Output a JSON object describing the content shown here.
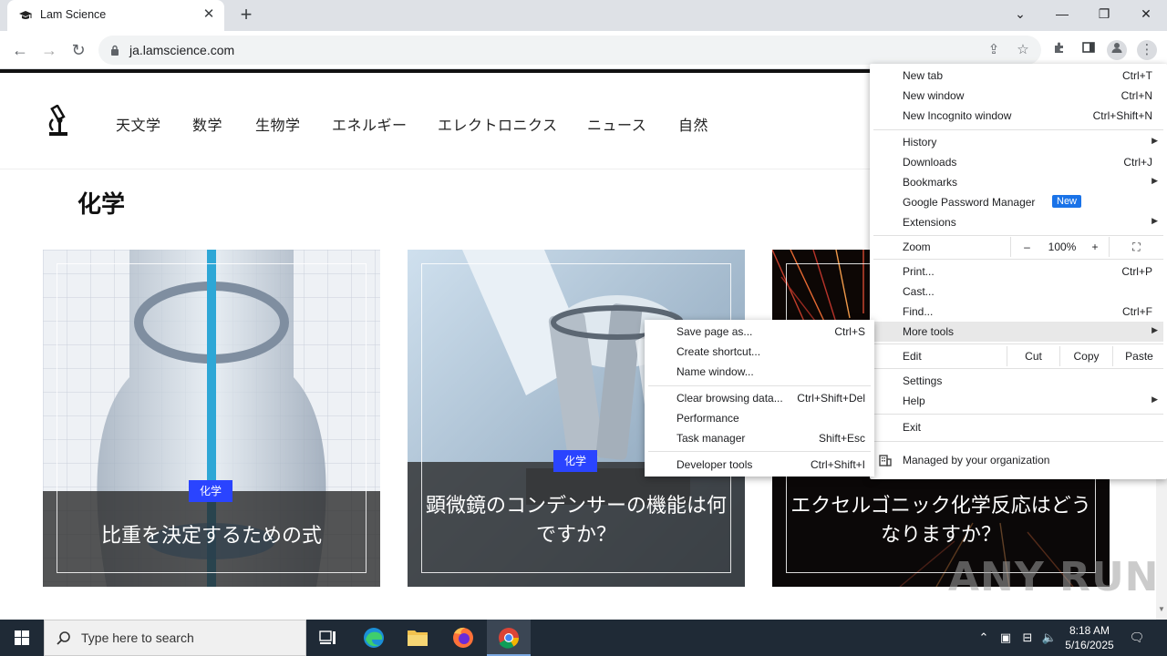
{
  "browser": {
    "tab_title": "Lam Science",
    "url": "ja.lamscience.com",
    "icons": [
      "back-icon",
      "forward-icon",
      "reload-icon",
      "lock-icon",
      "share-icon",
      "star-icon",
      "extensions-icon",
      "sidepanel-icon",
      "profile-icon",
      "menu-icon"
    ]
  },
  "site": {
    "nav": [
      "天文学",
      "数学",
      "生物学",
      "エネルギー",
      "エレクトロニクス",
      "ニュース",
      "自然"
    ],
    "section_title": "化学",
    "cards": [
      {
        "badge": "化学",
        "title": "比重を決定するための式"
      },
      {
        "badge": "化学",
        "title": "顕微鏡のコンデンサーの機能は何ですか？"
      },
      {
        "badge": "",
        "title": "エクセルゴニック化学反応はどうなりますか？"
      }
    ]
  },
  "menu": {
    "items": [
      {
        "label": "New tab",
        "shortcut": "Ctrl+T"
      },
      {
        "label": "New window",
        "shortcut": "Ctrl+N"
      },
      {
        "label": "New Incognito window",
        "shortcut": "Ctrl+Shift+N"
      },
      {
        "label": "History"
      },
      {
        "label": "Downloads",
        "shortcut": "Ctrl+J"
      },
      {
        "label": "Bookmarks"
      },
      {
        "label": "Google Password Manager",
        "badge": "New"
      },
      {
        "label": "Extensions"
      },
      {
        "label": "Zoom",
        "minus": "–",
        "value": "100%",
        "plus": "+"
      },
      {
        "label": "Print...",
        "shortcut": "Ctrl+P"
      },
      {
        "label": "Cast..."
      },
      {
        "label": "Find...",
        "shortcut": "Ctrl+F"
      },
      {
        "label": "More tools"
      },
      {
        "label": "Edit",
        "cut": "Cut",
        "copy": "Copy",
        "paste": "Paste"
      },
      {
        "label": "Settings"
      },
      {
        "label": "Help"
      },
      {
        "label": "Exit"
      },
      {
        "label": "Managed by your organization"
      }
    ]
  },
  "submenu": {
    "items": [
      {
        "label": "Save page as...",
        "shortcut": "Ctrl+S"
      },
      {
        "label": "Create shortcut..."
      },
      {
        "label": "Name window..."
      },
      {
        "label": "Clear browsing data...",
        "shortcut": "Ctrl+Shift+Del"
      },
      {
        "label": "Performance"
      },
      {
        "label": "Task manager",
        "shortcut": "Shift+Esc"
      },
      {
        "label": "Developer tools",
        "shortcut": "Ctrl+Shift+I"
      }
    ]
  },
  "watermark": "ANY RUN",
  "taskbar": {
    "search_placeholder": "Type here to search",
    "time": "8:18 AM",
    "date": "5/16/2025"
  }
}
